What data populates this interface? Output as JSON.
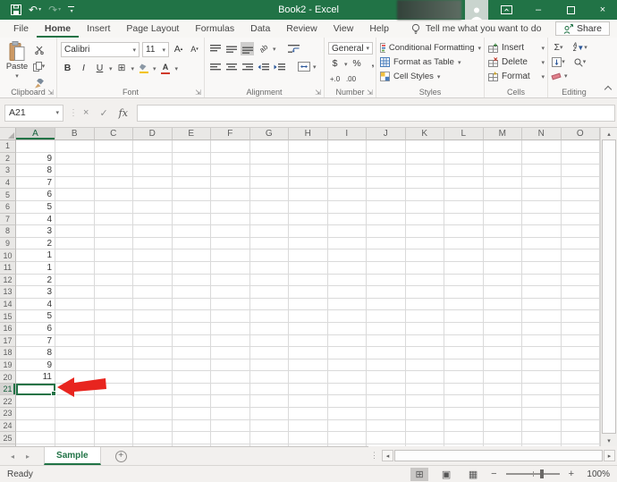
{
  "titlebar": {
    "title": "Book2 - Excel",
    "minimize_glyph": "–",
    "close_glyph": "×"
  },
  "tabs": [
    "File",
    "Home",
    "Insert",
    "Page Layout",
    "Formulas",
    "Data",
    "Review",
    "View",
    "Help"
  ],
  "active_tab": "Home",
  "tellme": {
    "label": "Tell me what you want to do"
  },
  "share": {
    "label": "Share"
  },
  "ribbon": {
    "clipboard": {
      "label": "Clipboard",
      "paste_label": "Paste"
    },
    "font": {
      "label": "Font",
      "family": "Calibri",
      "size": "11",
      "bold": "B",
      "italic": "I",
      "underline": "U"
    },
    "alignment": {
      "label": "Alignment",
      "orientation_text": "ab"
    },
    "number": {
      "label": "Number",
      "format": "General",
      "currency": "$",
      "percent": "%",
      "comma": ",",
      "dec_inc": "+.0",
      "dec_dec": ".00"
    },
    "styles": {
      "label": "Styles",
      "conditional": "Conditional Formatting",
      "format_table": "Format as Table",
      "cell_styles": "Cell Styles"
    },
    "cells": {
      "label": "Cells",
      "insert": "Insert",
      "delete": "Delete",
      "format": "Format"
    },
    "editing": {
      "label": "Editing",
      "autosum": "Σ",
      "sort_a": "A",
      "sort_z": "Z"
    }
  },
  "formula_bar": {
    "name_box": "A21",
    "fx": "fx",
    "formula": ""
  },
  "grid": {
    "columns": [
      "A",
      "B",
      "C",
      "D",
      "E",
      "F",
      "G",
      "H",
      "I",
      "J",
      "K",
      "L",
      "M",
      "N",
      "O"
    ],
    "row_count": 26,
    "selected_column": "A",
    "selected_row": 21,
    "selected_cell": "A21",
    "cells": {
      "A2": "9",
      "A3": "8",
      "A4": "7",
      "A5": "6",
      "A6": "5",
      "A7": "4",
      "A8": "3",
      "A9": "2",
      "A10": "1",
      "A11": "1",
      "A12": "2",
      "A13": "3",
      "A14": "4",
      "A15": "5",
      "A16": "6",
      "A17": "7",
      "A18": "8",
      "A19": "9",
      "A20": "11"
    }
  },
  "sheet_tabs": {
    "active": "Sample"
  },
  "status_bar": {
    "status": "Ready",
    "zoom_level": "100%"
  },
  "colors": {
    "accent": "#217346",
    "arrow": "#e8251f",
    "gridline": "#dadada"
  }
}
